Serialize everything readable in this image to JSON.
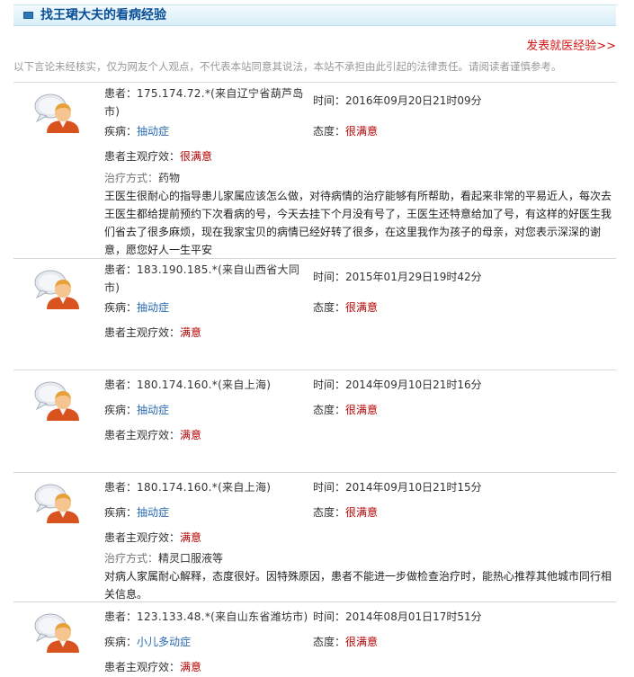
{
  "header": {
    "title": "找王珺大夫的看病经验"
  },
  "post_link": "发表就医经验>>",
  "disclaimer": "以下言论未经核实，仅为网友个人观点，不代表本站同意其说法，本站不承担由此引起的法律责任。请阅读者谨慎参考。",
  "labels": {
    "patient": "患者：",
    "disease": "疾病：",
    "time": "时间：",
    "attitude": "态度：",
    "effect": "患者主观疗效：",
    "method": "治疗方式："
  },
  "records": [
    {
      "ip": "175.174.72.*(来自辽宁省葫芦岛市)",
      "time": "2016年09月20日21时09分",
      "disease": "抽动症",
      "attitude": "很满意",
      "effect": "很满意",
      "method": "药物",
      "content": "王医生很耐心的指导患儿家属应该怎么做，对待病情的治疗能够有所帮助，看起来非常的平易近人，每次去王医生都给提前预约下次看病的号，今天去挂下个月没有号了，王医生还特意给加了号，有这样的好医生我们省去了很多麻烦，现在我家宝贝的病情已经好转了很多，在这里我作为孩子的母亲，对您表示深深的谢意，愿您好人一生平安"
    },
    {
      "ip": "183.190.185.*(来自山西省大同市)",
      "time": "2015年01月29日19时42分",
      "disease": "抽动症",
      "attitude": "很满意",
      "effect": "满意"
    },
    {
      "ip": "180.174.160.*(来自上海)",
      "time": "2014年09月10日21时16分",
      "disease": "抽动症",
      "attitude": "很满意",
      "effect": "满意"
    },
    {
      "ip": "180.174.160.*(来自上海)",
      "time": "2014年09月10日21时15分",
      "disease": "抽动症",
      "attitude": "很满意",
      "effect": "满意",
      "method": "精灵口服液等",
      "content": "对病人家属耐心解释，态度很好。因特殊原因，患者不能进一步做检查治疗时，能热心推荐其他城市同行相关信息。"
    },
    {
      "ip": "123.133.48.*(来自山东省潍坊市)",
      "time": "2014年08月01日17时51分",
      "disease": "小儿多动症",
      "attitude": "很满意",
      "effect": "满意"
    }
  ]
}
